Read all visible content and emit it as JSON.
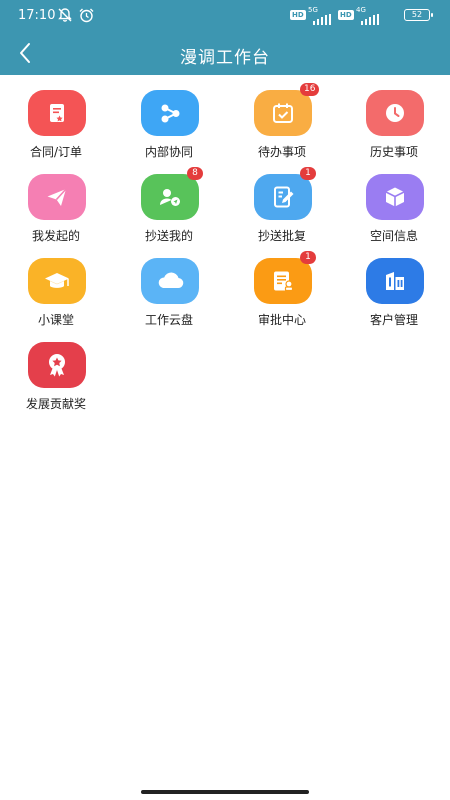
{
  "status_bar": {
    "time": "17:10",
    "hd1": "HD",
    "net1": "5G",
    "hd2": "HD",
    "net2": "4G",
    "battery": "52"
  },
  "header": {
    "title": "漫调工作台"
  },
  "colors": {
    "header_bg": "#3d96b1",
    "badge": "#e43c3c"
  },
  "apps": [
    {
      "label": "合同/订单",
      "badge": "",
      "color": "#f45455",
      "icon": "contract-icon"
    },
    {
      "label": "内部协同",
      "badge": "",
      "color": "#3ea6f5",
      "icon": "share-nodes-icon"
    },
    {
      "label": "待办事项",
      "badge": "16",
      "color": "#f9ad43",
      "icon": "calendar-check-icon"
    },
    {
      "label": "历史事项",
      "badge": "",
      "color": "#f36b6b",
      "icon": "clock-icon"
    },
    {
      "label": "我发起的",
      "badge": "",
      "color": "#f57fb3",
      "icon": "paper-plane-icon"
    },
    {
      "label": "抄送我的",
      "badge": "8",
      "color": "#58c35a",
      "icon": "user-send-icon"
    },
    {
      "label": "抄送批复",
      "badge": "1",
      "color": "#4ea8ef",
      "icon": "edit-note-icon"
    },
    {
      "label": "空间信息",
      "badge": "",
      "color": "#9a7df2",
      "icon": "cube-icon"
    },
    {
      "label": "小课堂",
      "badge": "",
      "color": "#fab327",
      "icon": "graduation-cap-icon"
    },
    {
      "label": "工作云盘",
      "badge": "",
      "color": "#5bb4f6",
      "icon": "cloud-icon"
    },
    {
      "label": "审批中心",
      "badge": "1",
      "color": "#fb9b14",
      "icon": "approval-doc-icon"
    },
    {
      "label": "客户管理",
      "badge": "",
      "color": "#2d7be6",
      "icon": "building-icon"
    },
    {
      "label": "发展贡献奖",
      "badge": "",
      "color": "#e43f4b",
      "icon": "award-ribbon-icon"
    }
  ]
}
